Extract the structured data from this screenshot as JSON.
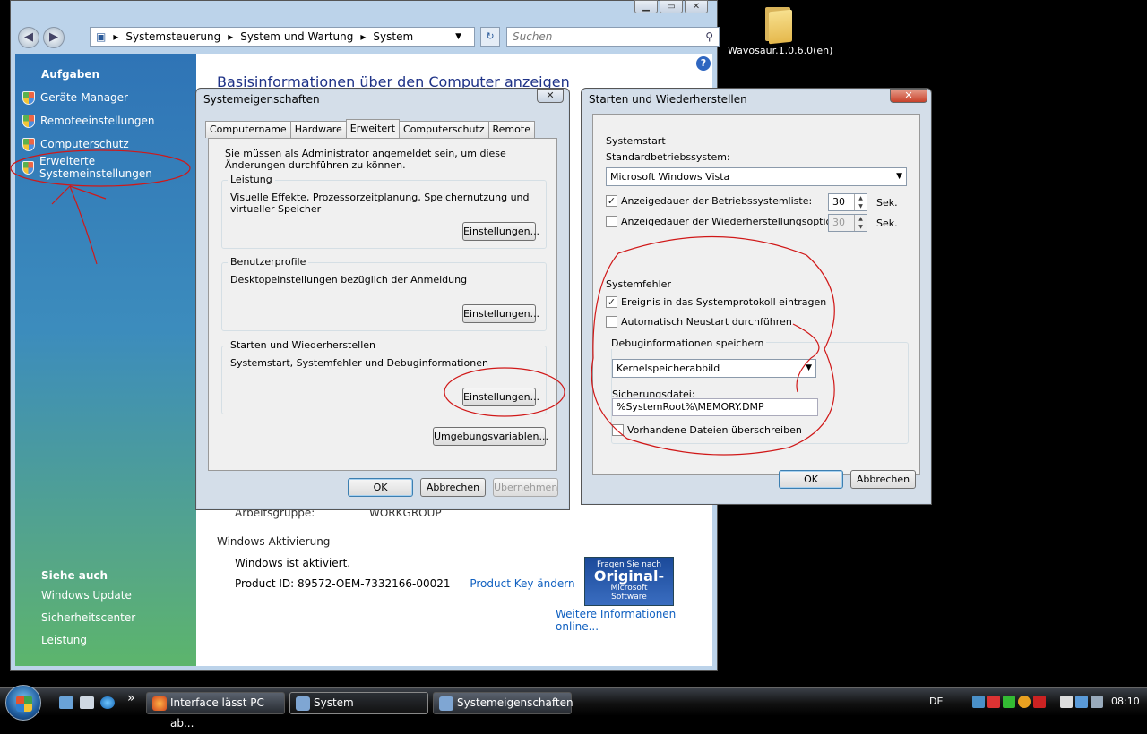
{
  "desktop": {
    "icon_label": "Wavosaur.1.0.6.0(en)"
  },
  "explorer": {
    "breadcrumb": [
      "Systemsteuerung",
      "System und Wartung",
      "System"
    ],
    "search_placeholder": "Suchen",
    "sidebar": {
      "heading": "Aufgaben",
      "items": [
        "Geräte-Manager",
        "Remoteeinstellungen",
        "Computerschutz",
        "Erweiterte Systemeinstellungen"
      ],
      "see_also_heading": "Siehe auch",
      "see_also": [
        "Windows Update",
        "Sicherheitscenter",
        "Leistung"
      ]
    },
    "page_title": "Basisinformationen über den Computer anzeigen",
    "workgroup_label": "Arbeitsgruppe:",
    "workgroup_value": "WORKGROUP",
    "activation_title": "Windows-Aktivierung",
    "activation_status": "Windows ist aktiviert.",
    "product_id_label": "Product ID:",
    "product_id": "89572-OEM-7332166-00021",
    "change_key_link": "Product Key ändern",
    "genuine_top": "Fragen Sie nach",
    "genuine_big": "Original-",
    "genuine_brand": "Microsoft",
    "genuine_bottom": "Software",
    "more_info_link": "Weitere Informationen online..."
  },
  "sysprops": {
    "title": "Systemeigenschaften",
    "tabs": [
      "Computername",
      "Hardware",
      "Erweitert",
      "Computerschutz",
      "Remote"
    ],
    "active_tab": "Erweitert",
    "admin_note": "Sie müssen als Administrator angemeldet sein, um diese Änderungen durchführen zu können.",
    "groups": [
      {
        "legend": "Leistung",
        "text": "Visuelle Effekte, Prozessorzeitplanung, Speichernutzung und virtueller Speicher",
        "button": "Einstellungen..."
      },
      {
        "legend": "Benutzerprofile",
        "text": "Desktopeinstellungen bezüglich der Anmeldung",
        "button": "Einstellungen..."
      },
      {
        "legend": "Starten und Wiederherstellen",
        "text": "Systemstart, Systemfehler und Debuginformationen",
        "button": "Einstellungen..."
      }
    ],
    "env_button": "Umgebungsvariablen...",
    "ok": "OK",
    "cancel": "Abbrechen",
    "apply": "Übernehmen"
  },
  "startup": {
    "title": "Starten und Wiederherstellen",
    "systemstart_legend": "Systemstart",
    "default_os_label": "Standardbetriebssystem:",
    "default_os_value": "Microsoft Windows Vista",
    "os_list_label": "Anzeigedauer der Betriebssystemliste:",
    "os_list_checked": true,
    "os_list_value": "30",
    "recovery_label": "Anzeigedauer der Wiederherstellungsoptionen:",
    "recovery_checked": false,
    "recovery_value": "30",
    "unit": "Sek.",
    "systemfehler_legend": "Systemfehler",
    "log_event_label": "Ereignis in das Systemprotokoll eintragen",
    "log_event_checked": true,
    "auto_restart_label": "Automatisch Neustart durchführen",
    "auto_restart_checked": false,
    "debug_legend": "Debuginformationen speichern",
    "debug_value": "Kernelspeicherabbild",
    "dump_file_label": "Sicherungsdatei:",
    "dump_file_value": "%SystemRoot%\\MEMORY.DMP",
    "overwrite_label": "Vorhandene Dateien überschreiben",
    "overwrite_checked": false,
    "ok": "OK",
    "cancel": "Abbrechen"
  },
  "taskbar": {
    "tasks": [
      "Interface lässt PC ab...",
      "System",
      "Systemeigenschaften"
    ],
    "active_task": "System",
    "quicklaunch_more": "»",
    "language": "DE",
    "clock": "08:10"
  },
  "colors": {
    "annotation_red": "#d01818",
    "link_blue": "#1060c0",
    "title_blue": "#1e3287"
  }
}
